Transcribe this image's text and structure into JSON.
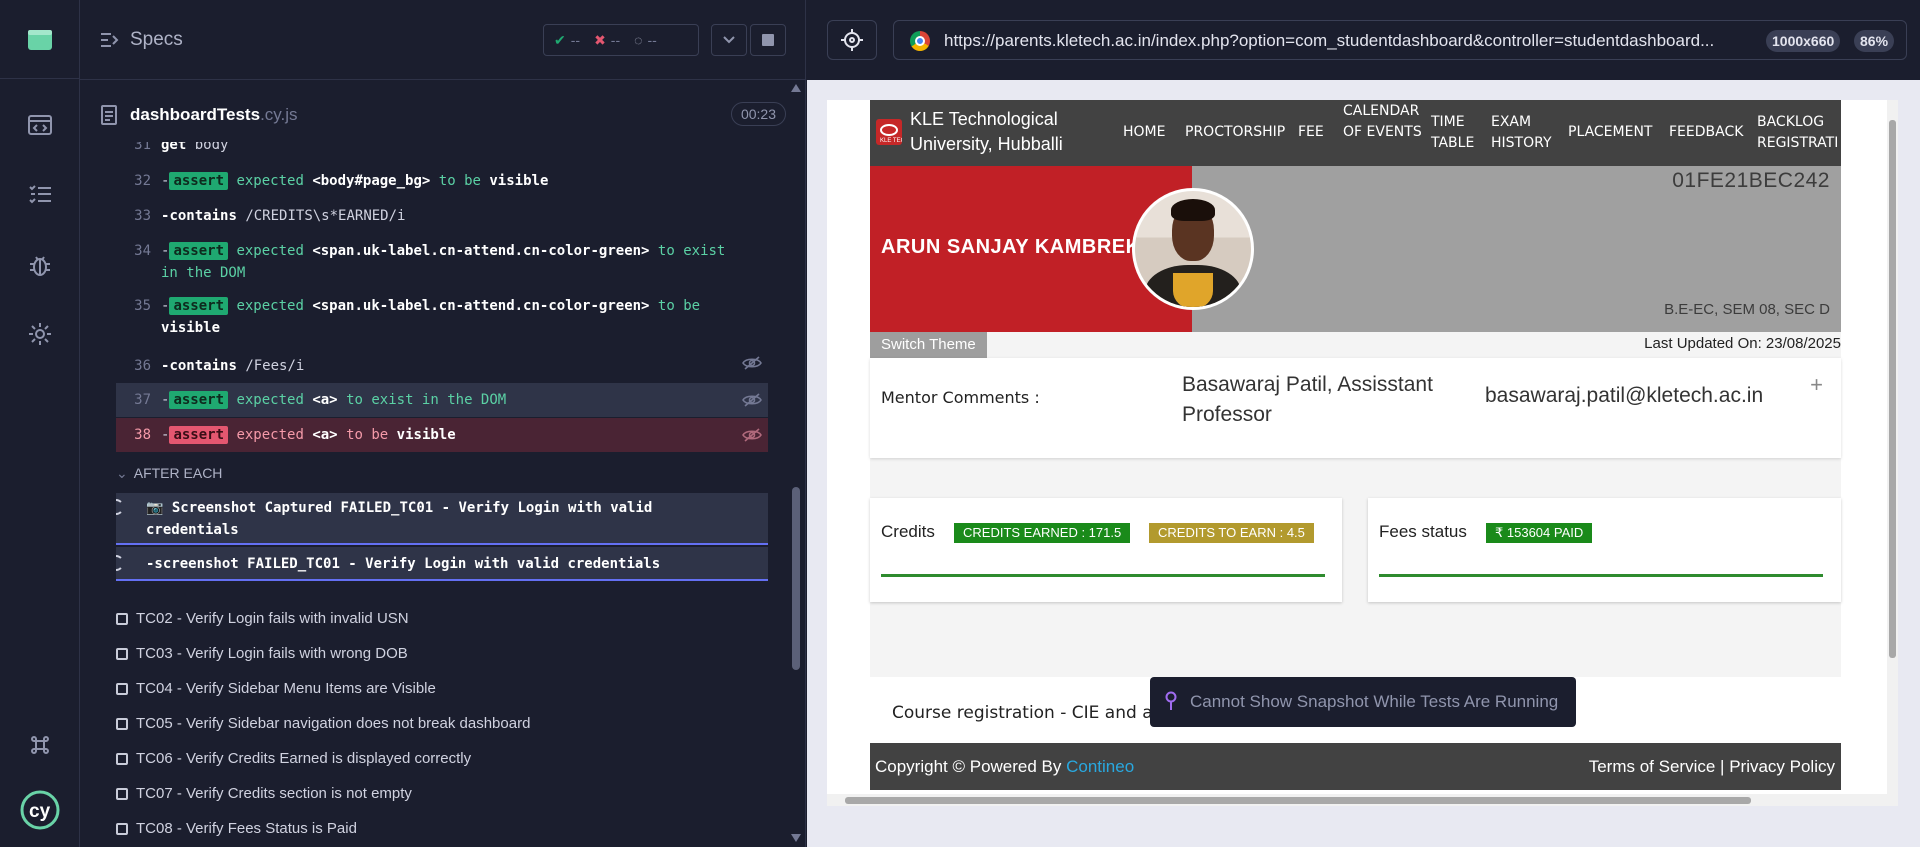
{
  "reporter": {
    "specs_label": "Specs",
    "stats": {
      "passed": "--",
      "failed": "--",
      "pending": "--"
    },
    "spec": {
      "name": "dashboardTests",
      "ext": ".cy.js",
      "duration": "00:23"
    },
    "commands": [
      {
        "num": "31",
        "cmd": "get",
        "arg": "body"
      },
      {
        "num": "32",
        "badge": "assert",
        "text_pre": "expected",
        "selector": "<body#page_bg>",
        "text_mid": "to be",
        "text_end": "visible"
      },
      {
        "num": "33",
        "cmd": "contains",
        "arg": "/CREDITS\\s*EARNED/i"
      },
      {
        "num": "34",
        "badge": "assert",
        "text_pre": "expected",
        "selector": "<span.uk-label.cn-attend.cn-color-green>",
        "text_mid": "to",
        "text_end": "exist in the DOM"
      },
      {
        "num": "35",
        "badge": "assert",
        "text_pre": "expected",
        "selector": "<span.uk-label.cn-attend.cn-color-green>",
        "text_mid": "to be",
        "text_end": "visible"
      },
      {
        "num": "36",
        "cmd": "contains",
        "arg": "/Fees/i"
      },
      {
        "num": "37",
        "badge": "assert",
        "text_pre": "expected",
        "selector": "<a>",
        "text_mid": "to exist in the DOM",
        "text_end": ""
      },
      {
        "num": "38",
        "badge": "assert",
        "text_pre": "expected",
        "selector": "<a>",
        "text_mid": "to be",
        "text_end": "visible"
      }
    ],
    "after_each_label": "AFTER EACH",
    "screenshot_captured": {
      "label": "Screenshot Captured",
      "value": "FAILED_TC01 - Verify Login with valid credentials"
    },
    "screenshot_cmd": {
      "label": "-screenshot",
      "value": "FAILED_TC01 - Verify Login with valid credentials"
    },
    "tests": [
      "TC02 - Verify Login fails with invalid USN",
      "TC03 - Verify Login fails with wrong DOB",
      "TC04 - Verify Sidebar Menu Items are Visible",
      "TC05 - Verify Sidebar navigation does not break dashboard",
      "TC06 - Verify Credits Earned is displayed correctly",
      "TC07 - Verify Credits section is not empty",
      "TC08 - Verify Fees Status is Paid"
    ]
  },
  "preview": {
    "url": "https://parents.kletech.ac.in/index.php?option=com_studentdashboard&controller=studentdashboard...",
    "viewport": "1000x660",
    "zoom": "86%",
    "snapshot_message": "Cannot Show Snapshot While Tests Are Running"
  },
  "site": {
    "university": "KLE Technological University, Hubballi",
    "nav": [
      "HOME",
      "PROCTORSHIP",
      "FEE",
      "CALENDAR OF EVENTS",
      "TIME TABLE",
      "EXAM HISTORY",
      "PLACEMENT",
      "FEEDBACK",
      "BACKLOG REGISTRATIO"
    ],
    "student_name": "ARUN SANJAY KAMBREK",
    "usn": "01FE21BEC242",
    "program": "B.E-EC, SEM 08, SEC D",
    "switch_theme": "Switch Theme",
    "last_updated": "Last Updated On: 23/08/2025",
    "mentor_label": "Mentor Comments :",
    "mentor_name": "Basawaraj Patil, Assisstant Professor",
    "mentor_email": "basawaraj.patil@kletech.ac.in",
    "credits_title": "Credits",
    "credits_earned": "CREDITS EARNED : 171.5",
    "credits_to_earn": "CREDITS TO EARN : 4.5",
    "fees_title": "Fees status",
    "fees_value": "₹ 153604 PAID",
    "course_reg": "Course registration - CIE and att",
    "copyright": "Copyright © Powered By",
    "copyright_link": "Contineo",
    "terms": "Terms of Service",
    "privacy": "Privacy Policy"
  },
  "colors": {
    "pass": "#1fa971",
    "fail": "#e45770",
    "accent": "#6470f3",
    "brand_red": "#c12026"
  }
}
